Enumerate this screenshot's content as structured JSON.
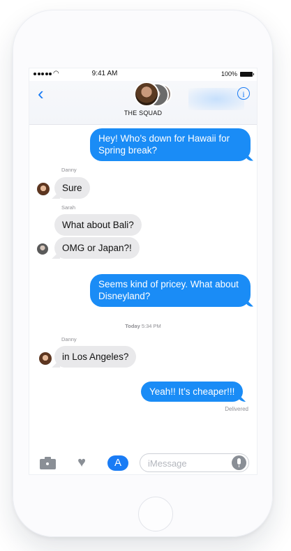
{
  "status_bar": {
    "time": "9:41 AM",
    "battery": "100%",
    "wifi_icon": "wifi-icon"
  },
  "header": {
    "group_name": "THE SQUAD",
    "back_icon": "chevron-left-icon",
    "info_icon": "info-icon",
    "info_glyph": "i"
  },
  "messages": [
    {
      "type": "sent",
      "text": "Hey! Who’s down for Hawaii for Spring break?"
    },
    {
      "type": "received",
      "sender": "Danny",
      "text": "Sure"
    },
    {
      "type": "received",
      "sender": "Sarah",
      "text": "What about Bali?"
    },
    {
      "type": "received",
      "sender": "",
      "text": "OMG or Japan?!"
    },
    {
      "type": "sent",
      "text": "Seems kind of pricey. What about Disneyland?"
    },
    {
      "type": "timestamp",
      "day": "Today",
      "time": "5:34 PM"
    },
    {
      "type": "received",
      "sender": "Danny",
      "text": "in Los Angeles?"
    },
    {
      "type": "sent",
      "text": "Yeah!! It’s cheaper!!!"
    }
  ],
  "delivered_label": "Delivered",
  "input_bar": {
    "placeholder": "iMessage",
    "camera_icon": "camera-icon",
    "digital_touch_icon": "heart-hand-icon",
    "app_store_icon": "app-store-icon",
    "app_store_glyph": "A",
    "mic_icon": "microphone-icon"
  },
  "colors": {
    "sent_bubble": "#1a8cf6",
    "received_bubble": "#e9e9eb",
    "accent": "#1a7cf5"
  }
}
